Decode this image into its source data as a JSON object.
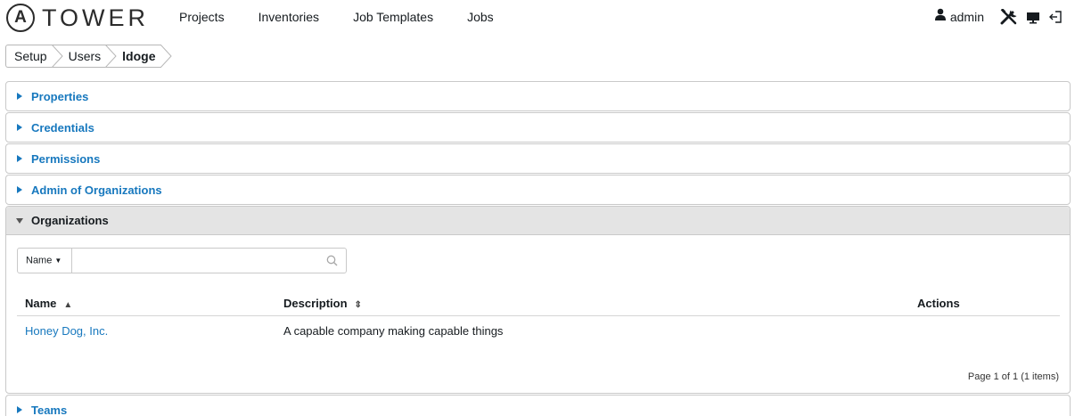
{
  "brand": {
    "logo_letter": "A",
    "name": "TOWER"
  },
  "nav": {
    "links": [
      "Projects",
      "Inventories",
      "Job Templates",
      "Jobs"
    ]
  },
  "user": {
    "name": "admin"
  },
  "icons": {
    "user": "user-icon",
    "setup": "wrench-screwdriver-icon",
    "monitor": "monitor-icon",
    "logout": "logout-icon"
  },
  "breadcrumb": [
    "Setup",
    "Users",
    "ldoge"
  ],
  "panels": {
    "properties": "Properties",
    "credentials": "Credentials",
    "permissions": "Permissions",
    "admin_orgs": "Admin of Organizations",
    "organizations": "Organizations",
    "teams": "Teams"
  },
  "organizations": {
    "search": {
      "field": "Name",
      "value": "",
      "placeholder": ""
    },
    "columns": {
      "name": "Name",
      "description": "Description",
      "actions": "Actions"
    },
    "rows": [
      {
        "name": "Honey Dog, Inc.",
        "description": "A capable company making capable things"
      }
    ],
    "pager": "Page 1 of 1 (1 items)"
  },
  "colors": {
    "link": "#1778be",
    "open_header": "#e4e4e4",
    "border": "#c9c9c9"
  }
}
